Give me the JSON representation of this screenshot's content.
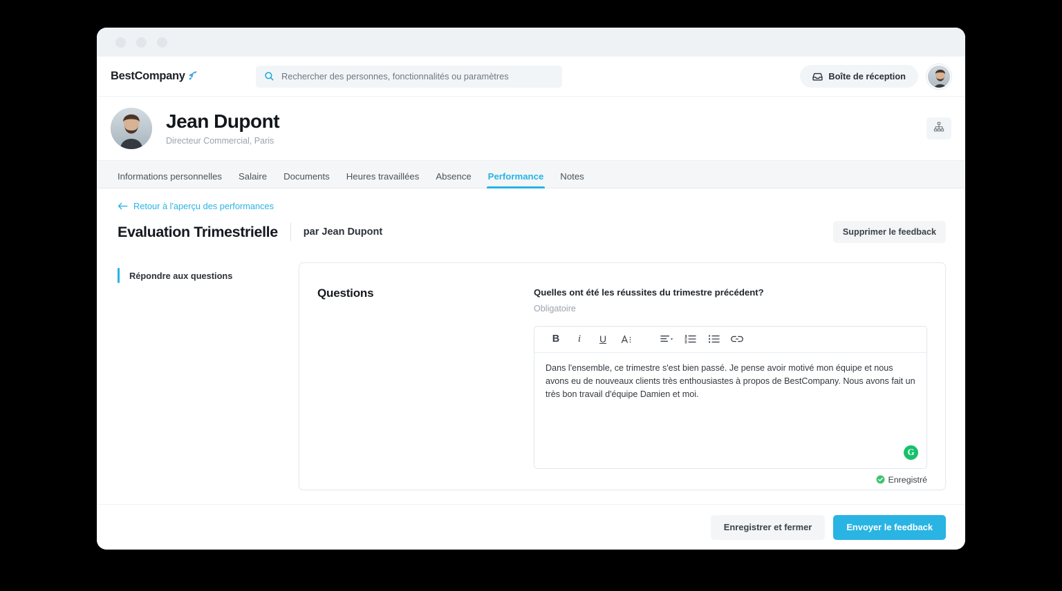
{
  "colors": {
    "accent": "#25b4e6",
    "primary_button": "#29b4e3",
    "grammarly_green": "#15c26b",
    "page_bg": "#ffffff",
    "tabbar_bg": "#f4f6f8",
    "chrome_bg": "#eef2f5"
  },
  "header": {
    "brand": "BestCompany",
    "brand_icon": "rocket-icon",
    "search": {
      "icon": "search-icon",
      "placeholder": "Rechercher des personnes, fonctionnalités ou paramètres",
      "value": ""
    },
    "inbox_label": "Boîte de réception",
    "inbox_icon": "inbox-icon",
    "avatar_alt": "user-avatar"
  },
  "profile": {
    "name": "Jean Dupont",
    "subtitle": "Directeur Commercial, Paris",
    "orgchart_icon": "org-chart-icon"
  },
  "tabs": [
    {
      "label": "Informations personnelles",
      "active": false
    },
    {
      "label": "Salaire",
      "active": false
    },
    {
      "label": "Documents",
      "active": false
    },
    {
      "label": "Heures travaillées",
      "active": false
    },
    {
      "label": "Absence",
      "active": false
    },
    {
      "label": "Performance",
      "active": true
    },
    {
      "label": "Notes",
      "active": false
    }
  ],
  "page": {
    "back_link": "Retour à l'aperçu des performances",
    "back_icon": "arrow-left-icon",
    "title": "Evaluation Trimestrielle",
    "author": "par Jean Dupont",
    "delete_label": "Supprimer le feedback"
  },
  "sidenav": {
    "items": [
      {
        "label": "Répondre aux questions",
        "active": true
      }
    ]
  },
  "card": {
    "section_title": "Questions",
    "question": {
      "text": "Quelles ont été les réussites du trimestre précédent?",
      "required_label": "Obligatoire"
    },
    "editor": {
      "toolbar": [
        {
          "name": "bold-icon",
          "glyph": "B"
        },
        {
          "name": "italic-icon",
          "glyph": "i"
        },
        {
          "name": "underline-icon",
          "glyph": "U"
        },
        {
          "name": "text-style-icon",
          "glyph": "A"
        },
        {
          "name": "align-icon",
          "glyph": "align"
        },
        {
          "name": "ordered-list-icon",
          "glyph": "ol"
        },
        {
          "name": "bullet-list-icon",
          "glyph": "ul"
        },
        {
          "name": "link-icon",
          "glyph": "link"
        }
      ],
      "value": "Dans l'ensemble, ce trimestre s'est bien passé. Je pense avoir motivé mon équipe et nous avons eu de nouveaux clients très enthousiastes à propos de BestCompany. Nous avons fait un très bon travail d'équipe Damien et moi.",
      "grammarly_badge": "G",
      "status_text": "Enregistré",
      "status_icon": "check-circle-icon"
    }
  },
  "footer": {
    "save_close_label": "Enregistrer et fermer",
    "submit_label": "Envoyer le feedback"
  }
}
